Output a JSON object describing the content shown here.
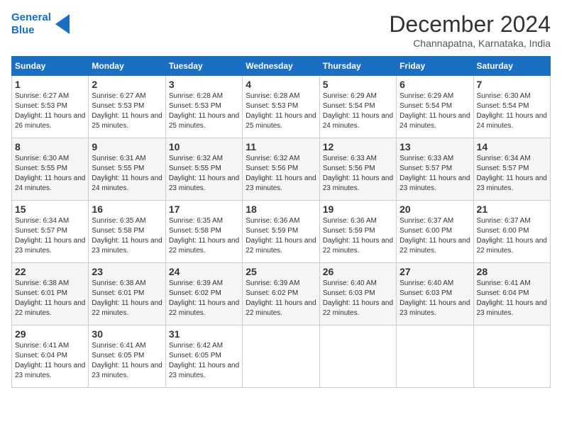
{
  "logo": {
    "line1": "General",
    "line2": "Blue"
  },
  "title": "December 2024",
  "subtitle": "Channapatna, Karnataka, India",
  "weekdays": [
    "Sunday",
    "Monday",
    "Tuesday",
    "Wednesday",
    "Thursday",
    "Friday",
    "Saturday"
  ],
  "weeks": [
    [
      {
        "day": "1",
        "sunrise": "6:27 AM",
        "sunset": "5:53 PM",
        "daylight": "11 hours and 26 minutes."
      },
      {
        "day": "2",
        "sunrise": "6:27 AM",
        "sunset": "5:53 PM",
        "daylight": "11 hours and 25 minutes."
      },
      {
        "day": "3",
        "sunrise": "6:28 AM",
        "sunset": "5:53 PM",
        "daylight": "11 hours and 25 minutes."
      },
      {
        "day": "4",
        "sunrise": "6:28 AM",
        "sunset": "5:53 PM",
        "daylight": "11 hours and 25 minutes."
      },
      {
        "day": "5",
        "sunrise": "6:29 AM",
        "sunset": "5:54 PM",
        "daylight": "11 hours and 24 minutes."
      },
      {
        "day": "6",
        "sunrise": "6:29 AM",
        "sunset": "5:54 PM",
        "daylight": "11 hours and 24 minutes."
      },
      {
        "day": "7",
        "sunrise": "6:30 AM",
        "sunset": "5:54 PM",
        "daylight": "11 hours and 24 minutes."
      }
    ],
    [
      {
        "day": "8",
        "sunrise": "6:30 AM",
        "sunset": "5:55 PM",
        "daylight": "11 hours and 24 minutes."
      },
      {
        "day": "9",
        "sunrise": "6:31 AM",
        "sunset": "5:55 PM",
        "daylight": "11 hours and 24 minutes."
      },
      {
        "day": "10",
        "sunrise": "6:32 AM",
        "sunset": "5:55 PM",
        "daylight": "11 hours and 23 minutes."
      },
      {
        "day": "11",
        "sunrise": "6:32 AM",
        "sunset": "5:56 PM",
        "daylight": "11 hours and 23 minutes."
      },
      {
        "day": "12",
        "sunrise": "6:33 AM",
        "sunset": "5:56 PM",
        "daylight": "11 hours and 23 minutes."
      },
      {
        "day": "13",
        "sunrise": "6:33 AM",
        "sunset": "5:57 PM",
        "daylight": "11 hours and 23 minutes."
      },
      {
        "day": "14",
        "sunrise": "6:34 AM",
        "sunset": "5:57 PM",
        "daylight": "11 hours and 23 minutes."
      }
    ],
    [
      {
        "day": "15",
        "sunrise": "6:34 AM",
        "sunset": "5:57 PM",
        "daylight": "11 hours and 23 minutes."
      },
      {
        "day": "16",
        "sunrise": "6:35 AM",
        "sunset": "5:58 PM",
        "daylight": "11 hours and 23 minutes."
      },
      {
        "day": "17",
        "sunrise": "6:35 AM",
        "sunset": "5:58 PM",
        "daylight": "11 hours and 22 minutes."
      },
      {
        "day": "18",
        "sunrise": "6:36 AM",
        "sunset": "5:59 PM",
        "daylight": "11 hours and 22 minutes."
      },
      {
        "day": "19",
        "sunrise": "6:36 AM",
        "sunset": "5:59 PM",
        "daylight": "11 hours and 22 minutes."
      },
      {
        "day": "20",
        "sunrise": "6:37 AM",
        "sunset": "6:00 PM",
        "daylight": "11 hours and 22 minutes."
      },
      {
        "day": "21",
        "sunrise": "6:37 AM",
        "sunset": "6:00 PM",
        "daylight": "11 hours and 22 minutes."
      }
    ],
    [
      {
        "day": "22",
        "sunrise": "6:38 AM",
        "sunset": "6:01 PM",
        "daylight": "11 hours and 22 minutes."
      },
      {
        "day": "23",
        "sunrise": "6:38 AM",
        "sunset": "6:01 PM",
        "daylight": "11 hours and 22 minutes."
      },
      {
        "day": "24",
        "sunrise": "6:39 AM",
        "sunset": "6:02 PM",
        "daylight": "11 hours and 22 minutes."
      },
      {
        "day": "25",
        "sunrise": "6:39 AM",
        "sunset": "6:02 PM",
        "daylight": "11 hours and 22 minutes."
      },
      {
        "day": "26",
        "sunrise": "6:40 AM",
        "sunset": "6:03 PM",
        "daylight": "11 hours and 22 minutes."
      },
      {
        "day": "27",
        "sunrise": "6:40 AM",
        "sunset": "6:03 PM",
        "daylight": "11 hours and 23 minutes."
      },
      {
        "day": "28",
        "sunrise": "6:41 AM",
        "sunset": "6:04 PM",
        "daylight": "11 hours and 23 minutes."
      }
    ],
    [
      {
        "day": "29",
        "sunrise": "6:41 AM",
        "sunset": "6:04 PM",
        "daylight": "11 hours and 23 minutes."
      },
      {
        "day": "30",
        "sunrise": "6:41 AM",
        "sunset": "6:05 PM",
        "daylight": "11 hours and 23 minutes."
      },
      {
        "day": "31",
        "sunrise": "6:42 AM",
        "sunset": "6:05 PM",
        "daylight": "11 hours and 23 minutes."
      },
      null,
      null,
      null,
      null
    ]
  ]
}
